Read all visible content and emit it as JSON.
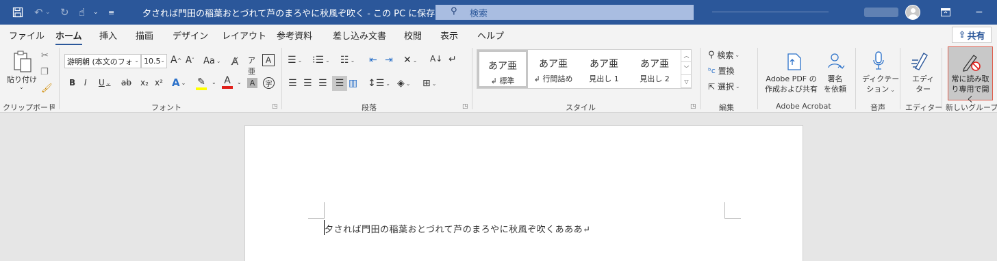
{
  "titlebar": {
    "title": "夕されば門田の稲葉おとづれて芦のまろやに秋風ぞ吹く - この PC に保存済み",
    "search_placeholder": "検索",
    "qat_icons": [
      "save-icon",
      "undo-icon",
      "redo-icon",
      "touch-mode-icon",
      "customize-qat-icon"
    ]
  },
  "tabs": [
    {
      "label": "ファイル"
    },
    {
      "label": "ホーム",
      "active": true
    },
    {
      "label": "挿入"
    },
    {
      "label": "描画"
    },
    {
      "label": "デザイン"
    },
    {
      "label": "レイアウト"
    },
    {
      "label": "参考資料"
    },
    {
      "label": "差し込み文書"
    },
    {
      "label": "校閲"
    },
    {
      "label": "表示"
    },
    {
      "label": "ヘルプ"
    }
  ],
  "share_label": "共有",
  "ribbon": {
    "clipboard": {
      "label": "クリップボード",
      "paste_label": "貼り付け"
    },
    "font": {
      "label": "フォント",
      "font_name": "游明朝 (本文のフォ",
      "font_size": "10.5",
      "grow_label": "A",
      "shrink_label": "A",
      "case_label": "Aa",
      "bold": "B",
      "italic": "I",
      "underline": "U",
      "strike": "ab",
      "subscript": "x₂",
      "superscript": "x²",
      "text_effect": "A",
      "font_color": "A",
      "char_shading": "A",
      "enclose": "字"
    },
    "paragraph": {
      "label": "段落"
    },
    "styles": {
      "label": "スタイル",
      "items": [
        {
          "sample": "あア亜",
          "name": "↲ 標準"
        },
        {
          "sample": "あア亜",
          "name": "↲ 行間詰め"
        },
        {
          "sample": "あア亜",
          "name": "見出し 1"
        },
        {
          "sample": "あア亜",
          "name": "見出し 2"
        }
      ]
    },
    "editing": {
      "label": "編集",
      "find": "検索",
      "replace": "置換",
      "select": "選択"
    },
    "acrobat": {
      "label": "Adobe Acrobat",
      "pdf_line1": "Adobe PDF の",
      "pdf_line2": "作成および共有",
      "sign_line1": "署名",
      "sign_line2": "を依頼"
    },
    "voice": {
      "label": "音声",
      "dictate_line1": "ディクテー",
      "dictate_line2": "ション"
    },
    "editor": {
      "label": "エディター",
      "btn_line1": "エディ",
      "btn_line2": "ター"
    },
    "newgroup": {
      "label": "新しいグループ",
      "btn_line1": "常に読み取",
      "btn_line2": "り専用で開く"
    }
  },
  "document": {
    "text": "夕されば門田の稲葉おとづれて芦のまろやに秋風ぞ吹くあああ↵"
  },
  "colors": {
    "brand": "#2b579a",
    "highlight_bar": "#ffff00",
    "font_color_bar": "#e0201b"
  }
}
